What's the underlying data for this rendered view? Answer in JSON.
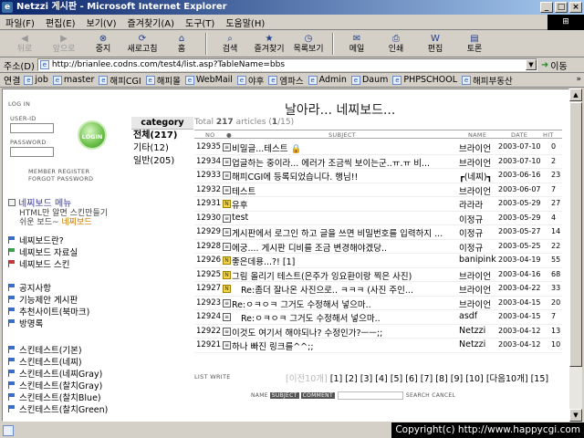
{
  "window": {
    "title": "Netzzi 게시판 - Microsoft Internet Explorer",
    "buttons": [
      "_",
      "□",
      "×"
    ]
  },
  "menu": {
    "items": [
      "파일(F)",
      "편집(E)",
      "보기(V)",
      "즐겨찾기(A)",
      "도구(T)",
      "도움말(H)"
    ]
  },
  "toolbar": {
    "buttons": [
      {
        "label": "뒤로",
        "icon": "back-arrow-icon",
        "disabled": true
      },
      {
        "label": "앞으로",
        "icon": "forward-arrow-icon",
        "disabled": true
      },
      {
        "label": "중지",
        "icon": "stop-icon",
        "disabled": false
      },
      {
        "label": "새로고침",
        "icon": "refresh-icon",
        "disabled": false
      },
      {
        "label": "홈",
        "icon": "home-icon",
        "disabled": false
      },
      {
        "label": "검색",
        "icon": "search-icon",
        "disabled": false
      },
      {
        "label": "즐겨찾기",
        "icon": "favorites-icon",
        "disabled": false
      },
      {
        "label": "목록보기",
        "icon": "history-icon",
        "disabled": false
      },
      {
        "label": "메일",
        "icon": "mail-icon",
        "disabled": false
      },
      {
        "label": "인쇄",
        "icon": "print-icon",
        "disabled": false
      },
      {
        "label": "편집",
        "icon": "edit-icon",
        "disabled": false
      },
      {
        "label": "토론",
        "icon": "discuss-icon",
        "disabled": false
      }
    ]
  },
  "address": {
    "label": "주소(D)",
    "url": "http://brianlee.codns.com/test4/list.asp?TableName=bbs",
    "go_label": "이동"
  },
  "links": {
    "label": "연결",
    "items": [
      "job",
      "master",
      "해피CGI",
      "해피몰",
      "WebMail",
      "야후",
      "엠파스",
      "Admin",
      "Daum",
      "PHPSCHOOL",
      "해피부동산"
    ]
  },
  "sidebar": {
    "login_title": "LOG IN",
    "user_id_label": "USER-ID",
    "password_label": "PASSWORD",
    "login_button": "LOGIN",
    "member_register": "MEMBER REGISTER",
    "forgot_password": "FORGOT PASSWORD",
    "menu_title": "네찌보드 메뉴",
    "desc_line1": "HTML만 알면 스킨만들기",
    "desc_line2": "쉬운 보드~",
    "desc_line2_highlight": "네찌보드",
    "group1": [
      "네찌보드란?",
      "네찌보드 자료실",
      "네찌보드 스킨"
    ],
    "group2": [
      "공지사항",
      "기능제안 게시판",
      "추천사이트(북마크)",
      "방명록"
    ],
    "group3": [
      "스킨테스트(기본)",
      "스킨테스트(네찌)",
      "스킨테스트(네찌Gray)",
      "스킨테스트(찰치Gray)",
      "스킨테스트(찰치Blue)",
      "스킨테스트(찰치Green)"
    ]
  },
  "category": {
    "header": "category",
    "items": [
      "전체(217)",
      "기타(12)",
      "일반(205)"
    ]
  },
  "board": {
    "title": "날아라... 네찌보드...",
    "total_prefix": "Total",
    "total_count": "217",
    "total_suffix": "articles (",
    "page_current": "1",
    "page_total": "/15)",
    "columns": {
      "no": "NO",
      "icon": "●",
      "subject": "SUBJECT",
      "name": "NAME",
      "date": "DATE",
      "hit": "HIT"
    },
    "rows": [
      {
        "no": "12935",
        "subject": "비밀글...테스트",
        "name": "브라이언",
        "date": "2003-07-10",
        "hit": "0",
        "icon": "doc",
        "lock": true
      },
      {
        "no": "12934",
        "subject": "업글하는 중이라... 에러가 조금씩 보이는군..ㅠ.ㅠ 비...",
        "name": "브라이언",
        "date": "2003-07-10",
        "hit": "2",
        "icon": "doc"
      },
      {
        "no": "12933",
        "subject": "해피CGI에 등록되었습니다. 행님!!",
        "name": "┏(네찌)┓",
        "date": "2003-06-16",
        "hit": "23",
        "icon": "doc"
      },
      {
        "no": "12932",
        "subject": "테스트",
        "name": "브라이언",
        "date": "2003-06-07",
        "hit": "7",
        "icon": "doc"
      },
      {
        "no": "12931",
        "subject": "유후",
        "name": "라라라",
        "date": "2003-05-29",
        "hit": "27",
        "icon": "new"
      },
      {
        "no": "12930",
        "subject": "test",
        "name": "이정규",
        "date": "2003-05-29",
        "hit": "4",
        "icon": "doc"
      },
      {
        "no": "12929",
        "subject": "게시판에서 로그인 하고 글을 쓰면 비밀번호를 입력하지 ...",
        "name": "이정규",
        "date": "2003-05-27",
        "hit": "14",
        "icon": "doc"
      },
      {
        "no": "12928",
        "subject": "에궁.... 게시판 디비를 조금 변경해야겠당..",
        "name": "이정규",
        "date": "2003-05-25",
        "hit": "22",
        "icon": "doc"
      },
      {
        "no": "12926",
        "subject": "좋은데용...?! [1]",
        "name": "banipink",
        "date": "2003-04-19",
        "hit": "55",
        "icon": "new"
      },
      {
        "no": "12925",
        "subject": "그림 올리기 테스트(은주가 잉요환이랑 찍은 사진)",
        "name": "브라이언",
        "date": "2003-04-16",
        "hit": "68",
        "icon": "new"
      },
      {
        "no": "12927",
        "subject": "Re:좀더 잘나온 사진으로.. ㅋㅋㅋ (사진 주인...",
        "name": "브라이언",
        "date": "2003-04-22",
        "hit": "33",
        "icon": "new",
        "reply": true
      },
      {
        "no": "12923",
        "subject": "Re:ㅇㅋㅇㅋ 그거도 수정해서 넣으마..",
        "name": "브라이언",
        "date": "2003-04-15",
        "hit": "20",
        "icon": "doc"
      },
      {
        "no": "12924",
        "subject": "Re:ㅇㅋㅇㅋ 그거도 수정해서 넣으마..",
        "name": "asdf",
        "date": "2003-04-15",
        "hit": "7",
        "icon": "doc",
        "reply": true
      },
      {
        "no": "12922",
        "subject": "이것도 여기서 해야되나? 수정인가?ㅡㅡ;;",
        "name": "Netzzi",
        "date": "2003-04-12",
        "hit": "13",
        "icon": "doc"
      },
      {
        "no": "12921",
        "subject": "하나 빠진 링크를^^;;",
        "name": "Netzzi",
        "date": "2003-04-12",
        "hit": "10",
        "icon": "doc"
      }
    ]
  },
  "footer": {
    "list_label": "LIST",
    "write_label": "WRITE",
    "prev_dim": "[이전10개]",
    "pages": [
      "[1]",
      "[2]",
      "[3]",
      "[4]",
      "[5]",
      "[6]",
      "[7]",
      "[8]",
      "[9]",
      "[10]"
    ],
    "next": "[다음10개]",
    "last": "[15]"
  },
  "search": {
    "name_label": "NAME",
    "subject_label": "SUBJECT",
    "comment_label": "COMMENT",
    "search_label": "SEARCH",
    "cancel_label": "CANCEL"
  },
  "status": {
    "copyright": "Copyright(c) http://www.happycgi.com"
  }
}
